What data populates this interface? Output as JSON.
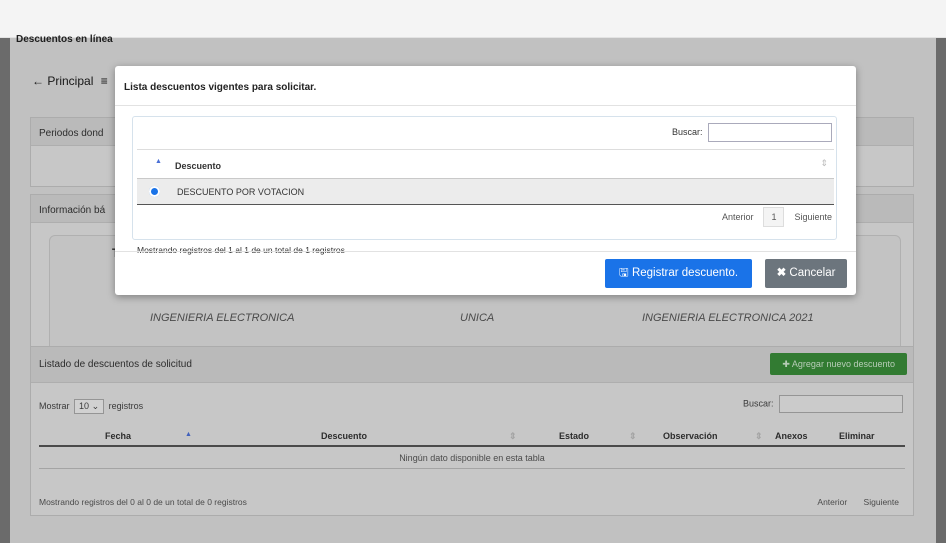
{
  "page": {
    "title": "Descuentos en línea",
    "nav_principal": "← Principal",
    "nav_menu": "≡"
  },
  "panels": {
    "periodos_title": "Periodos dond",
    "info_title": "Información bá",
    "info_t": "T",
    "info_values": [
      "INGENIERIA ELECTRONICA",
      "UNICA",
      "INGENIERIA ELECTRONICA 2021"
    ],
    "listado_title": "Listado de descuentos de solicitud",
    "add_button": "✚ Agregar nuevo descuento"
  },
  "listado_table": {
    "mostrar_label": "Mostrar",
    "mostrar_value": "10",
    "registros_label": "registros",
    "buscar_label": "Buscar:",
    "columns": [
      "Fecha",
      "Descuento",
      "Estado",
      "Observación",
      "Anexos",
      "Eliminar"
    ],
    "empty_text": "Ningún dato disponible en esta tabla",
    "footer_text": "Mostrando registros del 0 al 0 de un total de 0 registros",
    "prev": "Anterior",
    "next": "Siguiente"
  },
  "modal": {
    "title": "Lista descuentos vigentes para solicitar.",
    "buscar_label": "Buscar:",
    "column": "Descuento",
    "rows": [
      {
        "label": "DESCUENTO POR VOTACION",
        "selected": true
      }
    ],
    "footer_text": "Mostrando registros del 1 al 1 de un total de 1 registros",
    "prev": "Anterior",
    "page": "1",
    "next": "Siguiente",
    "register_button": "Registrar descuento.",
    "cancel_button": "Cancelar"
  },
  "colors": {
    "primary": "#1a73e8",
    "secondary": "#6c757d",
    "success": "#3a8c3a"
  }
}
